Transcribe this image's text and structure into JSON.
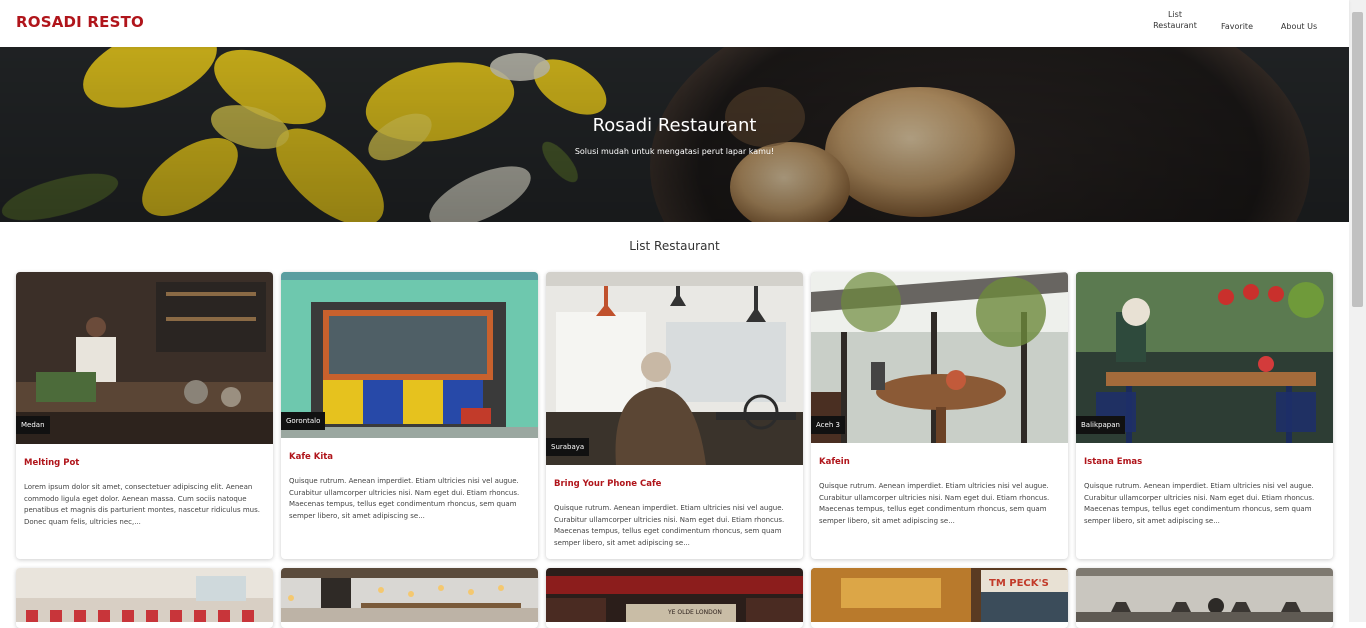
{
  "header": {
    "brand": "ROSADI RESTO",
    "nav": [
      {
        "label_line1": "List",
        "label_line2": "Restaurant"
      },
      {
        "label_line1": "Favorite",
        "label_line2": ""
      },
      {
        "label_line1": "About Us",
        "label_line2": ""
      }
    ]
  },
  "hero": {
    "title": "Rosadi Restaurant",
    "subtitle": "Solusi mudah untuk mengatasi perut lapar kamu!"
  },
  "section": {
    "title": "List Restaurant"
  },
  "restaurants": [
    {
      "name": "Melting Pot",
      "city": "Medan",
      "description": "Lorem ipsum dolor sit amet, consectetuer adipiscing elit. Aenean commodo ligula eget dolor. Aenean massa. Cum sociis natoque penatibus et magnis dis parturient montes, nascetur ridiculus mus. Donec quam felis, ultricies nec,..."
    },
    {
      "name": "Kafe Kita",
      "city": "Gorontalo",
      "description": "Quisque rutrum. Aenean imperdiet. Etiam ultricies nisi vel augue. Curabitur ullamcorper ultricies nisi. Nam eget dui. Etiam rhoncus. Maecenas tempus, tellus eget condimentum rhoncus, sem quam semper libero, sit amet adipiscing se..."
    },
    {
      "name": "Bring Your Phone Cafe",
      "city": "Surabaya",
      "description": "Quisque rutrum. Aenean imperdiet. Etiam ultricies nisi vel augue. Curabitur ullamcorper ultricies nisi. Nam eget dui. Etiam rhoncus. Maecenas tempus, tellus eget condimentum rhoncus, sem quam semper libero, sit amet adipiscing se..."
    },
    {
      "name": "Kafein",
      "city": "Aceh 3",
      "description": "Quisque rutrum. Aenean imperdiet. Etiam ultricies nisi vel augue. Curabitur ullamcorper ultricies nisi. Nam eget dui. Etiam rhoncus. Maecenas tempus, tellus eget condimentum rhoncus, sem quam semper libero, sit amet adipiscing se..."
    },
    {
      "name": "Istana Emas",
      "city": "Balikpapan",
      "description": "Quisque rutrum. Aenean imperdiet. Etiam ultricies nisi vel augue. Curabitur ullamcorper ultricies nisi. Nam eget dui. Etiam rhoncus. Maecenas tempus, tellus eget condimentum rhoncus, sem quam semper libero, sit amet adipiscing se..."
    }
  ],
  "sign_texts": [
    "YE OLDE LONDON",
    "TM PECK'S"
  ],
  "colors": {
    "brand": "#b0151b",
    "city_badge": "#111111"
  }
}
